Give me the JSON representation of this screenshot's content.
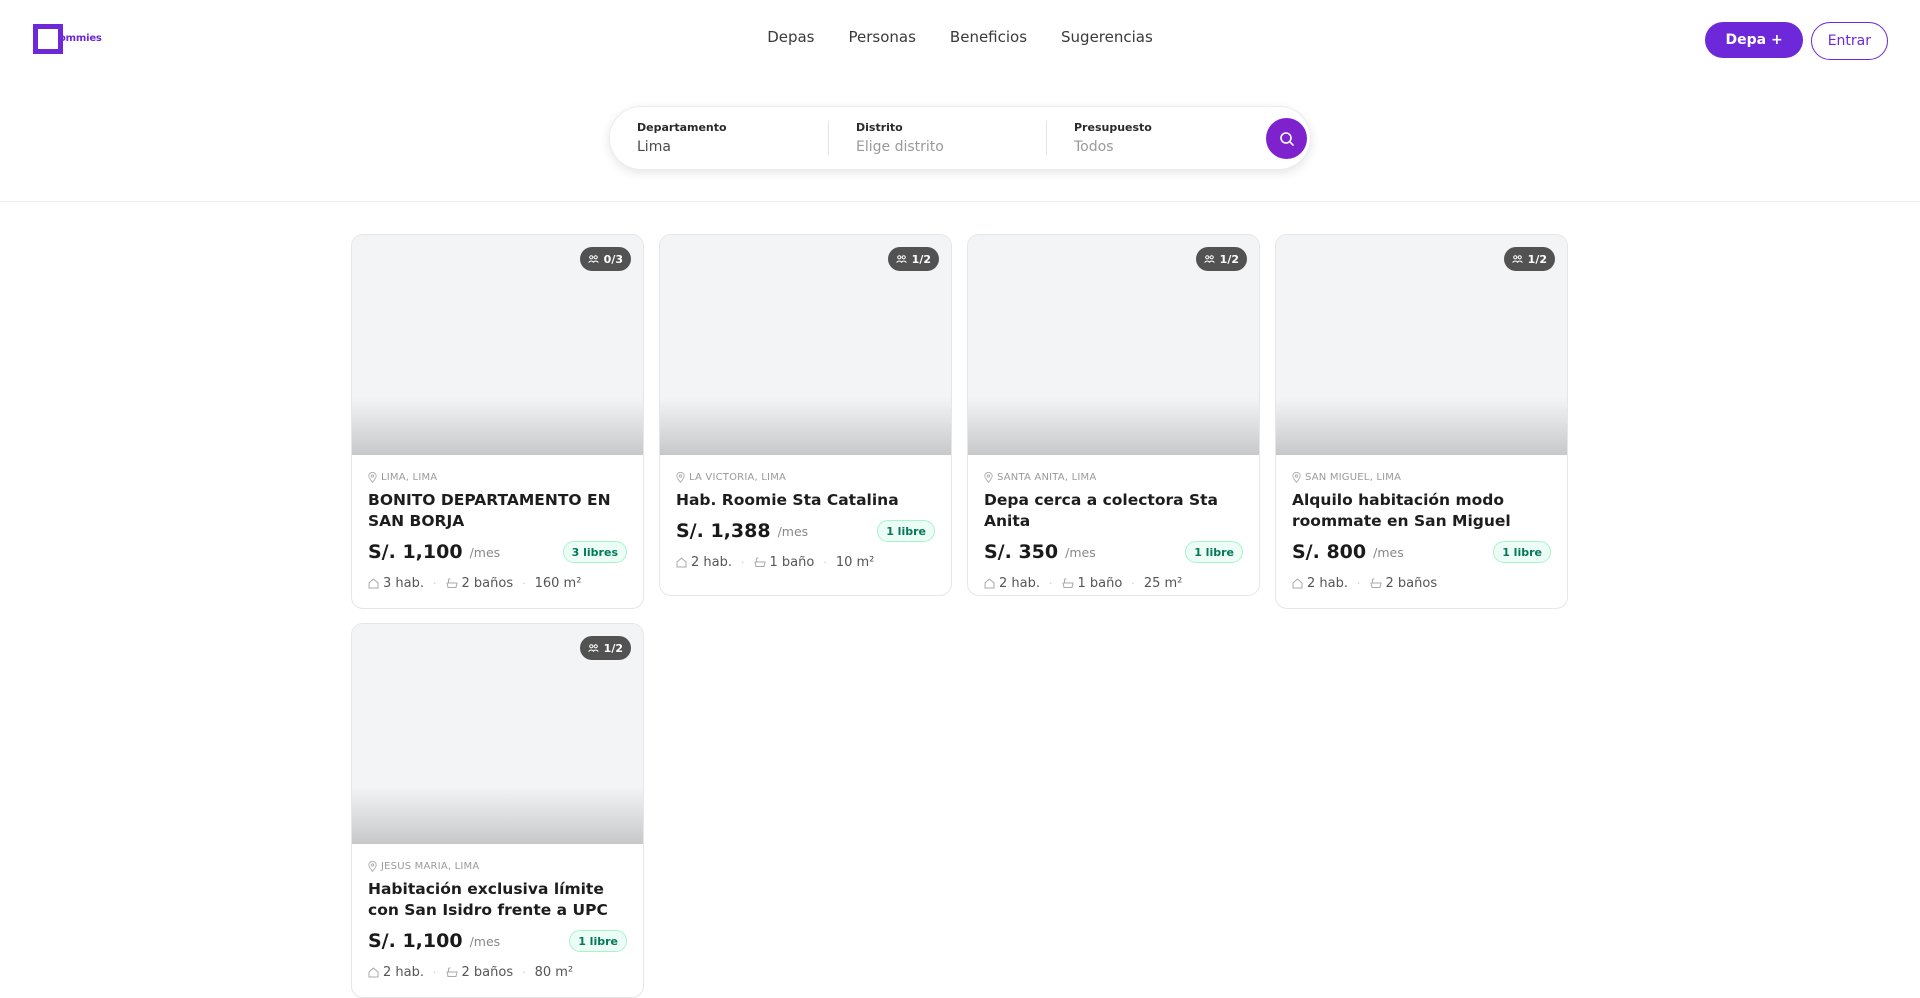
{
  "brand": {
    "name": "ommies",
    "color": "#6d28d9"
  },
  "nav": [
    {
      "label": "Depas"
    },
    {
      "label": "Personas"
    },
    {
      "label": "Beneficios"
    },
    {
      "label": "Sugerencias"
    }
  ],
  "actions": {
    "primary_label": "Depa +",
    "login_label": "Entrar"
  },
  "search": {
    "departamento": {
      "label": "Departamento",
      "value": "Lima"
    },
    "distrito": {
      "label": "Distrito",
      "placeholder": "Elige distrito"
    },
    "presupuesto": {
      "label": "Presupuesto",
      "placeholder": "Todos"
    },
    "icon": "search-icon"
  },
  "listings": [
    {
      "occupancy": "0/3",
      "location": "LIMA, LIMA",
      "title": "BONITO DEPARTAMENTO EN SAN BORJA",
      "price": "S/. 1,100",
      "per": "/mes",
      "availability": "3 libres",
      "rooms": "3 hab.",
      "baths": "2 baños",
      "area": "160 m²"
    },
    {
      "occupancy": "1/2",
      "location": "LA VICTORIA, LIMA",
      "title": "Hab. Roomie Sta Catalina",
      "price": "S/. 1,388",
      "per": "/mes",
      "availability": "1 libre",
      "rooms": "2 hab.",
      "baths": "1 baño",
      "area": "10 m²"
    },
    {
      "occupancy": "1/2",
      "location": "SANTA ANITA, LIMA",
      "title": "Depa cerca a colectora Sta Anita",
      "price": "S/. 350",
      "per": "/mes",
      "availability": "1 libre",
      "rooms": "2 hab.",
      "baths": "1 baño",
      "area": "25 m²"
    },
    {
      "occupancy": "1/2",
      "location": "SAN MIGUEL, LIMA",
      "title": "Alquilo habitación modo roommate en San Miguel",
      "price": "S/. 800",
      "per": "/mes",
      "availability": "1 libre",
      "rooms": "2 hab.",
      "baths": "2 baños",
      "area": ""
    },
    {
      "occupancy": "1/2",
      "location": "JESUS MARIA, LIMA",
      "title": "Habitación exclusiva límite con San Isidro frente a UPC",
      "price": "S/. 1,100",
      "per": "/mes",
      "availability": "1 libre",
      "rooms": "2 hab.",
      "baths": "2 baños",
      "area": "80 m²"
    }
  ]
}
